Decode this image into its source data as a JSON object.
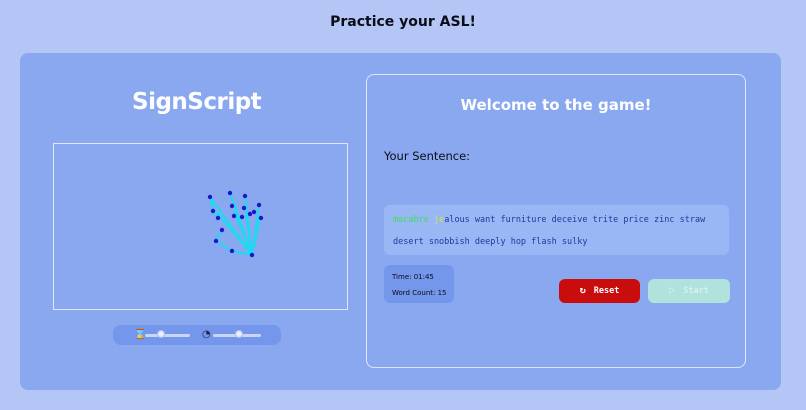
{
  "page": {
    "title": "Practice your ASL!"
  },
  "left": {
    "logo": "SignScript",
    "controls": {
      "speed_icon": "hourglass-icon",
      "speed_level": 0.35,
      "gauge_icon": "speedometer-icon",
      "gauge_level": 0.55
    }
  },
  "game": {
    "welcome": "Welcome to the game!",
    "sentence_label": "Your Sentence:",
    "sentence": {
      "completed": "macabre ",
      "current_typed": "je",
      "remaining_line1": "alous want furniture deceive trite price zinc straw",
      "line2": "desert snobbish deeply hop flash sulky"
    },
    "stats": {
      "time": "Time: 01:45",
      "word_count": "Word Count: 15"
    },
    "buttons": {
      "reset_label": "Reset",
      "reset_icon": "refresh-icon",
      "start_label": "Start",
      "start_icon": "play-icon"
    }
  },
  "colors": {
    "background": "#b4c6f5",
    "card": "#8aa8f0",
    "reset": "#c90d0d",
    "start_disabled": "#b2e2dc",
    "completed_word": "#3de05b",
    "current_word": "#d2e640"
  }
}
